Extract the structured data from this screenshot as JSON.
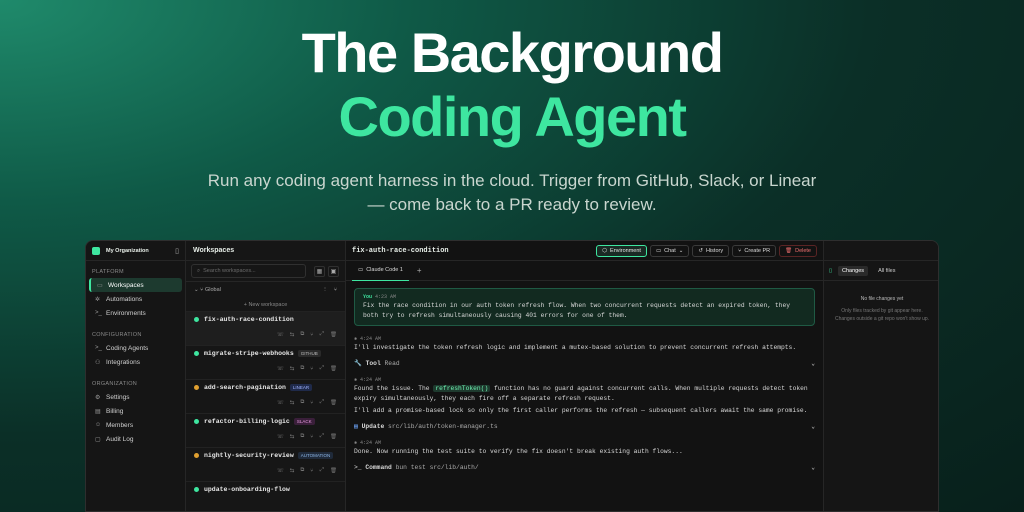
{
  "hero": {
    "title_line1": "The Background",
    "title_line2": "Coding Agent",
    "subtitle": "Run any coding agent harness in the cloud. Trigger from GitHub, Slack, or Linear — come back to a PR ready to review."
  },
  "sidebar": {
    "org": "My Organization",
    "sections": [
      {
        "label": "PLATFORM",
        "items": [
          "Workspaces",
          "Automations",
          "Environments"
        ]
      },
      {
        "label": "CONFIGURATION",
        "items": [
          "Coding Agents",
          "Integrations"
        ]
      },
      {
        "label": "ORGANIZATION",
        "items": [
          "Settings",
          "Billing",
          "Members",
          "Audit Log"
        ]
      }
    ]
  },
  "workspaces": {
    "title": "Workspaces",
    "search_placeholder": "Search workspaces...",
    "group": "Global",
    "new_label": "+ New workspace",
    "items": [
      {
        "name": "fix-auth-race-condition",
        "badge": ""
      },
      {
        "name": "migrate-stripe-webhooks",
        "badge": "GITHUB"
      },
      {
        "name": "add-search-pagination",
        "badge": "LINEAR"
      },
      {
        "name": "refactor-billing-logic",
        "badge": "SLACK"
      },
      {
        "name": "nightly-security-review",
        "badge": "AUTOMATION"
      },
      {
        "name": "update-onboarding-flow",
        "badge": ""
      }
    ]
  },
  "main": {
    "title": "fix-auth-race-condition",
    "toolbar": {
      "environment": "Environment",
      "chat": "Chat",
      "history": "History",
      "create_pr": "Create PR",
      "delete": "Delete"
    },
    "tab": "Claude Code 1",
    "you_label": "You",
    "you_time": "4:23 AM",
    "you_text": "Fix the race condition in our auth token refresh flow. When two concurrent requests detect an expired token, they both try to refresh simultaneously causing 401 errors for one of them.",
    "t1": "4:24 AM",
    "m1": "I'll investigate the token refresh logic and implement a mutex-based solution to prevent concurrent refresh attempts.",
    "tool_label": "Tool",
    "tool_value": "Read",
    "t2": "4:24 AM",
    "m2a": "Found the issue. The",
    "m2code": "refreshToken()",
    "m2b": "function has no guard against concurrent calls. When multiple requests detect token expiry simultaneously, they each fire off a separate refresh request.",
    "m2c": "I'll add a promise-based lock so only the first caller performs the refresh — subsequent callers await the same promise.",
    "update_label": "Update",
    "update_path": "src/lib/auth/token-manager.ts",
    "t3": "4:24 AM",
    "m3": "Done. Now running the test suite to verify the fix doesn't break existing auth flows...",
    "cmd_label": "Command",
    "cmd_value": "bun test src/lib/auth/"
  },
  "right": {
    "tab1": "Changes",
    "tab2": "All files",
    "empty_title": "No file changes yet",
    "empty_desc": "Only files tracked by git appear here. Changes outside a git repo won't show up."
  }
}
